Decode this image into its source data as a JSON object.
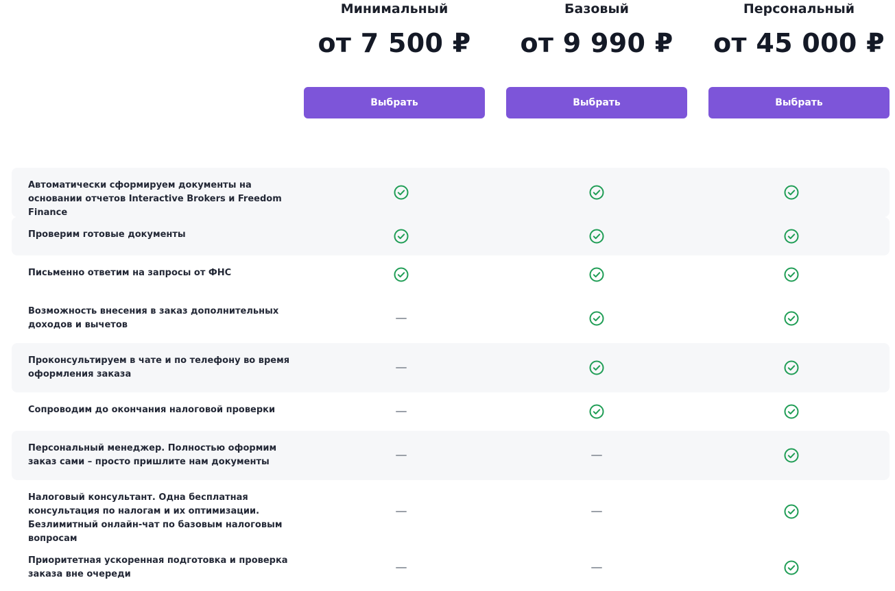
{
  "plans": [
    {
      "name": "Минимальный",
      "price": "от 7 500 ₽",
      "button_label": "Выбрать"
    },
    {
      "name": "Базовый",
      "price": "от 9 990 ₽",
      "button_label": "Выбрать"
    },
    {
      "name": "Персональный",
      "price": "от 45 000 ₽",
      "button_label": "Выбрать"
    }
  ],
  "colors": {
    "accent": "#7d55d9",
    "check": "#1f9d55",
    "dash": "#9aa0a8",
    "row_shade": "#f6f7f9"
  },
  "icons": {
    "included": "check-circle-icon",
    "not_included": "dash-icon"
  },
  "features": [
    {
      "label": "Автоматически сформируем документы на основании отчетов Interactive Brokers и Freedom Finance",
      "included": [
        true,
        true,
        true
      ]
    },
    {
      "label": "Проверим готовые документы",
      "included": [
        true,
        true,
        true
      ]
    },
    {
      "label": "Письменно ответим на запросы от ФНС",
      "included": [
        true,
        true,
        true
      ]
    },
    {
      "label": "Возможность внесения в заказ дополнительных доходов и вычетов",
      "included": [
        false,
        true,
        true
      ]
    },
    {
      "label": "Проконсультируем в чате и по телефону во время оформления заказа",
      "included": [
        false,
        true,
        true
      ]
    },
    {
      "label": "Сопроводим до окончания налоговой проверки",
      "included": [
        false,
        true,
        true
      ]
    },
    {
      "label": "Персональный менеджер. Полностью оформим заказ сами – просто пришлите нам документы",
      "included": [
        false,
        false,
        true
      ]
    },
    {
      "label": "Налоговый консультант. Одна бесплатная консультация по налогам и их оптимизации. Безлимитный онлайн-чат по базовым налоговым вопросам",
      "included": [
        false,
        false,
        true
      ]
    },
    {
      "label": "Приоритетная ускоренная подготовка и проверка заказа вне очереди",
      "included": [
        false,
        false,
        true
      ]
    }
  ]
}
